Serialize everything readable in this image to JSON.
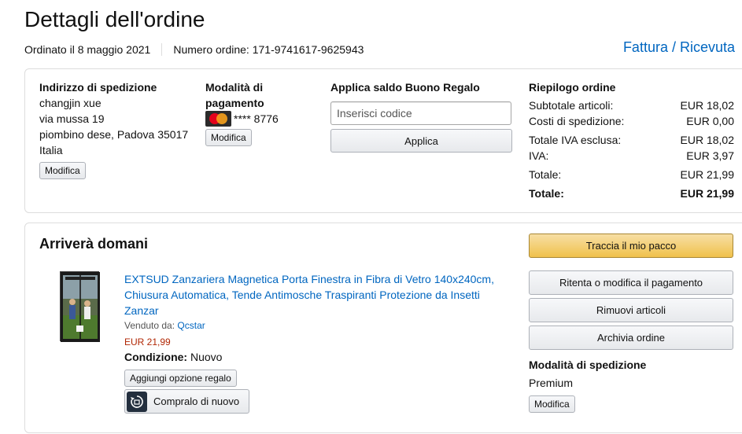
{
  "header": {
    "title": "Dettagli dell'ordine",
    "ordered_on": "Ordinato il 8 maggio 2021",
    "order_number": "Numero ordine: 171-9741617-9625943",
    "invoice_link": "Fattura / Ricevuta"
  },
  "shipping_address": {
    "heading": "Indirizzo di spedizione",
    "lines": [
      "changjin xue",
      "via mussa 19",
      "piombino dese, Padova 35017",
      "Italia"
    ],
    "edit_label": "Modifica"
  },
  "payment": {
    "heading_line1": "Modalità di",
    "heading_line2": "pagamento",
    "card_icon": "mastercard-icon",
    "card_label": "**** 8776",
    "edit_label": "Modifica"
  },
  "gift_card": {
    "heading": "Applica saldo Buono Regalo",
    "placeholder": "Inserisci codice",
    "apply_label": "Applica"
  },
  "summary": {
    "heading": "Riepilogo ordine",
    "rows": [
      {
        "label": "Subtotale articoli:",
        "value": "EUR 18,02"
      },
      {
        "label": "Costi di spedizione:",
        "value": "EUR 0,00"
      },
      {
        "label": "Totale IVA esclusa:",
        "value": "EUR 18,02"
      },
      {
        "label": "IVA:",
        "value": "EUR 3,97"
      },
      {
        "label": "Totale:",
        "value": "EUR 21,99"
      }
    ],
    "grand_total_label": "Totale:",
    "grand_total_value": "EUR 21,99"
  },
  "shipment": {
    "status": "Arriverà domani",
    "item": {
      "title": "EXTSUD Zanzariera Magnetica Porta Finestra in Fibra di Vetro 140x240cm, Chiusura Automatica, Tende Antimosche Traspiranti Protezione da Insetti Zanzar",
      "sold_by_label": "Venduto da:",
      "seller": "Qcstar",
      "price": "EUR 21,99",
      "condition_label": "Condizione:",
      "condition_value": "Nuovo",
      "gift_option_label": "Aggiungi opzione regalo",
      "buy_again_label": "Compralo di nuovo"
    },
    "actions": {
      "track": "Traccia il mio pacco",
      "retry_payment": "Ritenta o modifica il pagamento",
      "remove_items": "Rimuovi articoli",
      "archive": "Archivia ordine"
    },
    "shipping_method": {
      "heading": "Modalità di spedizione",
      "value": "Premium",
      "edit_label": "Modifica"
    }
  },
  "colors": {
    "link": "#0066c0",
    "price": "#b12704",
    "primary_button": "#f0c14b"
  }
}
